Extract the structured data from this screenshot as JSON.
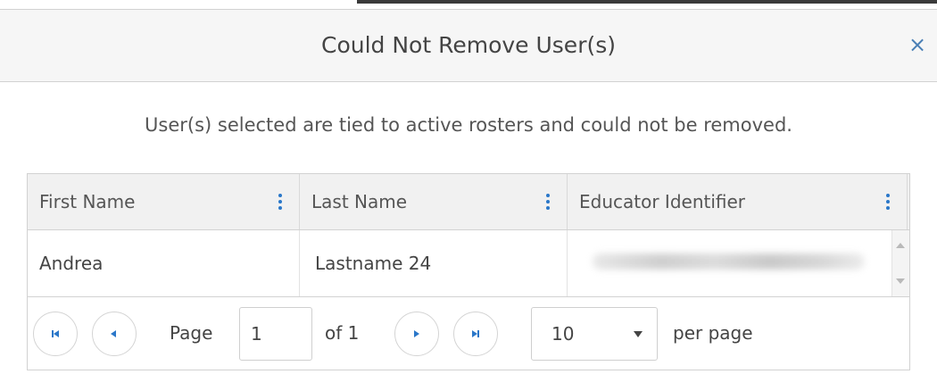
{
  "dialog": {
    "title": "Could Not Remove User(s)",
    "close_glyph": "×",
    "message": "User(s) selected are tied to active rosters and could not be removed."
  },
  "grid": {
    "columns": [
      {
        "label": "First Name"
      },
      {
        "label": "Last Name"
      },
      {
        "label": "Educator Identifier"
      }
    ],
    "rows": [
      {
        "first_name": "Andrea",
        "last_name": "Lastname 24",
        "educator_identifier_blurred": true
      }
    ]
  },
  "pager": {
    "page_label": "Page",
    "current_page": "1",
    "of_label": "of 1",
    "page_size": "10",
    "per_page_label": "per page"
  },
  "colors": {
    "accent": "#2a77c9",
    "header_bg": "#f6f6f6",
    "grid_header_bg": "#f1f1f1",
    "border": "#d2d2d2"
  },
  "icons": [
    "close-icon",
    "column-menu-icon",
    "first-page-icon",
    "prev-page-icon",
    "next-page-icon",
    "last-page-icon",
    "dropdown-caret-icon",
    "scroll-up-icon",
    "scroll-down-icon"
  ]
}
